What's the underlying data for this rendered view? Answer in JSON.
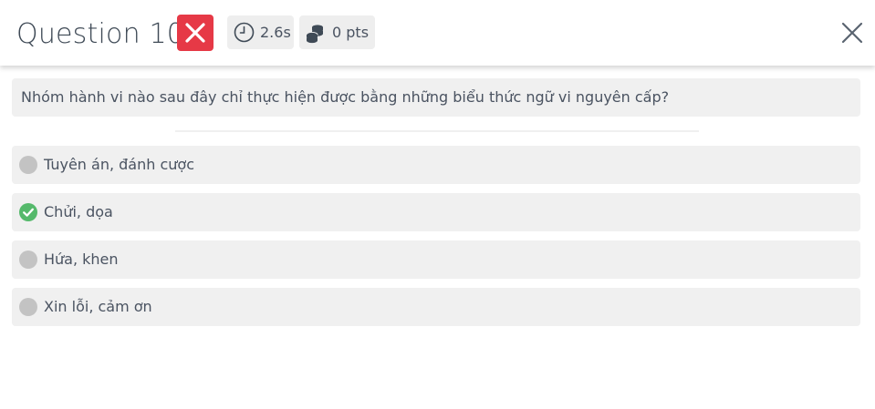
{
  "header": {
    "title": "Question 10",
    "result_icon": "close-x-icon",
    "time_icon": "clock-icon",
    "time_value": "2.6s",
    "points_icon": "coins-icon",
    "points_value": "0 pts",
    "close_icon": "close-icon"
  },
  "question": {
    "text": "Nhóm hành vi nào sau đây chỉ thực hiện được bằng những biểu thức ngữ vi nguyên cấp?"
  },
  "options": [
    {
      "label": "Tuyên án, đánh cược",
      "status": "neutral"
    },
    {
      "label": "Chửi, dọa",
      "status": "correct"
    },
    {
      "label": "Hứa, khen",
      "status": "neutral"
    },
    {
      "label": "Xin lỗi, cảm ơn",
      "status": "neutral"
    }
  ],
  "colors": {
    "wrong": "#e63946",
    "correct": "#55b96b",
    "neutral_dot": "#c3c3c3",
    "box_bg": "#f0f0f0",
    "text": "#4a5361"
  }
}
